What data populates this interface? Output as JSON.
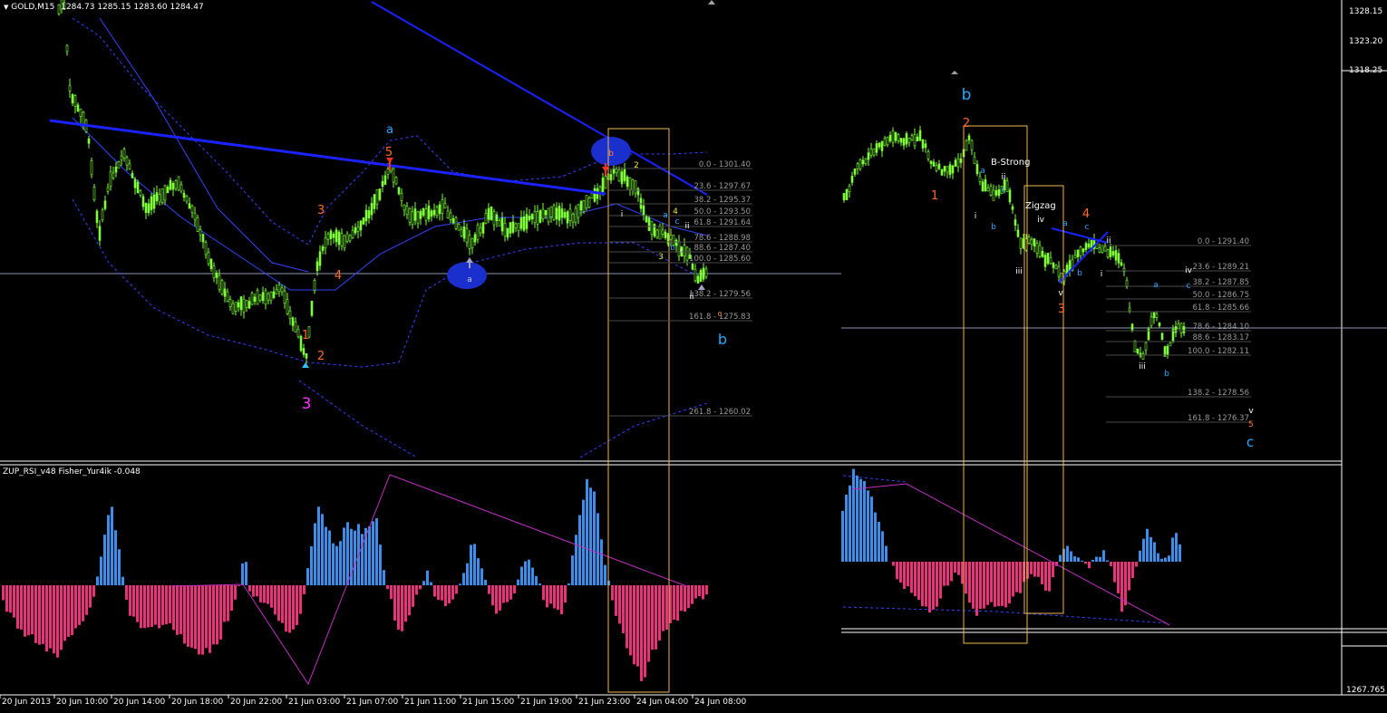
{
  "header": {
    "symbol": "GOLD,M15",
    "ohlc": "1284.73 1285.15 1283.60 1284.47"
  },
  "indicator": {
    "label": "ZUP_RSI_v48  Fisher_Yur4ik -0.048"
  },
  "price_axis": [
    "1328.15",
    "1323.20",
    "1318.25",
    "1267.765"
  ],
  "time_axis": [
    "20 Jun 2013",
    "20 Jun 10:00",
    "20 Jun 14:00",
    "20 Jun 18:00",
    "20 Jun 22:00",
    "21 Jun 03:00",
    "21 Jun 07:00",
    "21 Jun 11:00",
    "21 Jun 15:00",
    "21 Jun 19:00",
    "21 Jun 23:00",
    "24 Jun 04:00",
    "24 Jun 08:00"
  ],
  "fib_left": [
    "0.0 - 1301.40",
    "23.6 - 1297.67",
    "38.2 - 1295.37",
    "50.0 - 1293.50",
    "61.8 - 1291.64",
    "78.6 - 1288.98",
    "88.6 - 1287.40",
    "100.0 - 1285.60",
    "138.2 - 1279.56",
    "161.8 - 1275.83",
    "261.8 - 1260.02"
  ],
  "fib_right": [
    "0.0 - 1291.40",
    "23.6 - 1289.21",
    "38.2 - 1287.85",
    "50.0 - 1286.75",
    "61.8 - 1285.66",
    "78.6 - 1284.10",
    "88.6 - 1283.17",
    "100.0 - 1282.11",
    "138.2 - 1278.56",
    "161.8 - 1276.37"
  ],
  "waves_left": {
    "a_blue": "a",
    "w5": "5",
    "w3": "3",
    "w4": "4",
    "w1": "1",
    "w2": "2",
    "w3_magenta": "3",
    "a_circle": "a",
    "b_circle": "b",
    "w2_yellow": "2",
    "w4_yellow": "4",
    "w3_yellow": "3",
    "i": "i",
    "ii": "ii",
    "sub_a": "a",
    "sub_b": "b",
    "sub_c": "c",
    "c_orange": "c",
    "b_blue": "b",
    "ii_low": "ii",
    "iii": "i"
  },
  "waves_right": {
    "b_big": "b",
    "w2": "2",
    "w1": "1",
    "b_strong": "B-Strong",
    "zigzag": "Zigzag",
    "ii_top": "ii",
    "a1": "a",
    "c1": "c",
    "i1": "i",
    "b1": "b",
    "iii1": "iii",
    "iv": "iv",
    "a2": "a",
    "w4": "4",
    "c2": "c",
    "ii2": "ii",
    "b2": "b",
    "i2": "i",
    "v": "v",
    "w3": "3",
    "iv2": "iv",
    "c3": "c",
    "a3": "a",
    "iii2": "iii",
    "b3": "b",
    "v2": "v",
    "w5": "5",
    "c_big": "c"
  },
  "colors": {
    "bull_candle": "#7fff3a",
    "bear_candle": "#7fff3a",
    "trend_blue": "#1a22ff",
    "band_blue": "#3344ff",
    "hist_pos": "#3d8ee8",
    "hist_neg": "#e8327a",
    "box_orange": "#f0b850",
    "wave_orange": "#ff6a2a",
    "wave_blue": "#2aa8ff",
    "wave_yellow": "#e8e840",
    "wave_magenta": "#ff30ff",
    "magenta_line": "#c030c0"
  }
}
